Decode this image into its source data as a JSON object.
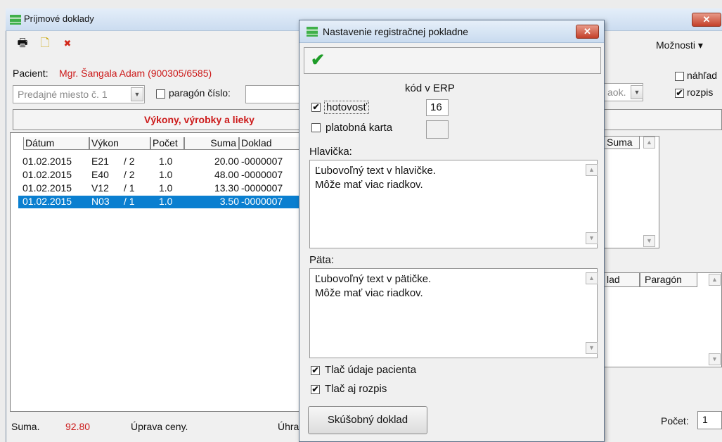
{
  "main": {
    "title": "Príjmové doklady",
    "close": "✕",
    "toolbar": {
      "print_icon": "🖶",
      "new_icon": "🗋",
      "delete_icon": "✖"
    },
    "moznosti": "Možnosti ▾",
    "patient_label": "Pacient:",
    "patient_name": "Mgr. Šangala Adam (900305/6585)",
    "predajne_miesto": "Predajné miesto č. 1",
    "paragon_label": "paragón číslo:",
    "section_title": "Výkony, výrobky a lieky",
    "columns": [
      "Dátum",
      "Výkon",
      "Počet",
      "Suma",
      "Doklad"
    ],
    "rows": [
      {
        "datum": "01.02.2015",
        "vykon": "E21",
        "kat": "/ 2",
        "pocet": "1.0",
        "suma": "20.00",
        "doklad": "-0000007",
        "selected": false
      },
      {
        "datum": "01.02.2015",
        "vykon": "E40",
        "kat": "/ 2",
        "pocet": "1.0",
        "suma": "48.00",
        "doklad": "-0000007",
        "selected": false
      },
      {
        "datum": "01.02.2015",
        "vykon": "V12",
        "kat": "/ 1",
        "pocet": "1.0",
        "suma": "13.30",
        "doklad": "-0000007",
        "selected": false
      },
      {
        "datum": "01.02.2015",
        "vykon": "N03",
        "kat": "/ 1",
        "pocet": "1.0",
        "suma": "3.50",
        "doklad": "-0000007",
        "selected": true
      }
    ],
    "suma_label": "Suma.",
    "suma_value": "92.80",
    "uprava_ceny": "Úprava ceny.",
    "uhra": "Úhra",
    "nahlad": "náhľad",
    "rozpis": "rozpis",
    "aok": "aok.",
    "right_table1_header": "Suma",
    "right_table2_headers": [
      "lad",
      "Paragón"
    ],
    "pocet_label": "Počet:",
    "pocet_value": "1"
  },
  "dialog": {
    "title": "Nastavenie registračnej pokladne",
    "close": "✕",
    "ok_icon": "✔",
    "kod_header": "kód v ERP",
    "hotovost": "hotovosť",
    "hotovost_code": "16",
    "platobna_karta": "platobná karta",
    "hlavicka_label": "Hlavička:",
    "hlavicka_text": "Ľubovoľný text v hlavičke.\nMôže mať viac riadkov.",
    "pata_label": "Päta:",
    "pata_text": "Ľubovoľný text v pätičke.\nMôže mať viac riadkov.",
    "tlac_pacienta": "Tlač údaje pacienta",
    "tlac_rozpis": "Tlač aj rozpis",
    "skusobny": "Skúšobný doklad",
    "checked_mark": "✔"
  },
  "colors": {
    "accent_red": "#cc1a1a",
    "selection": "#0a7fd0",
    "ok_green": "#1e9c28"
  }
}
